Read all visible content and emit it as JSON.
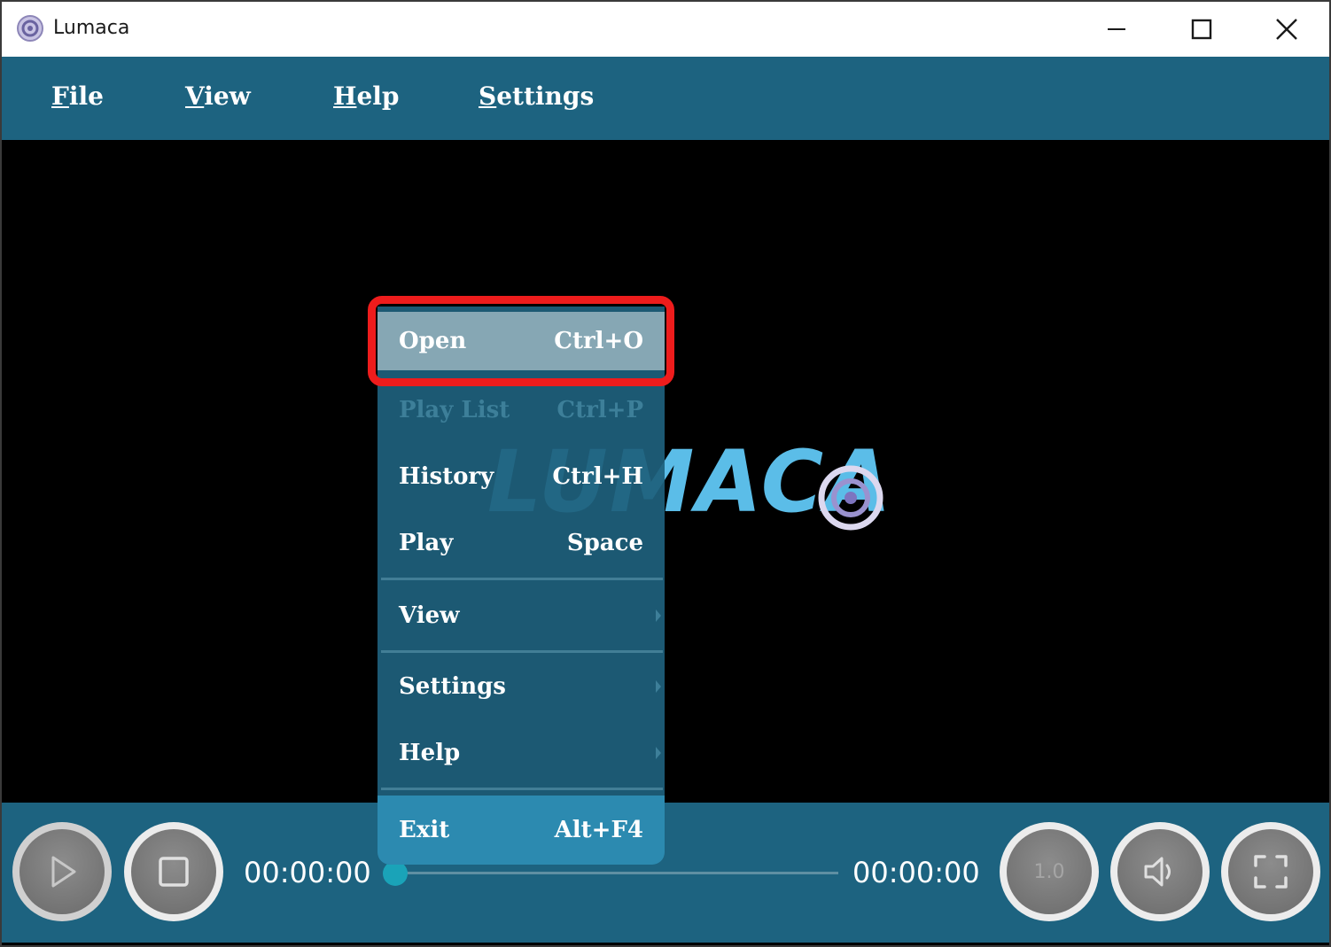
{
  "window": {
    "title": "Lumaca"
  },
  "menubar": {
    "items": [
      {
        "mnemonic": "F",
        "rest": "ile"
      },
      {
        "mnemonic": "V",
        "rest": "iew"
      },
      {
        "mnemonic": "H",
        "rest": "elp"
      },
      {
        "mnemonic": "S",
        "rest": "ettings"
      }
    ]
  },
  "logo": {
    "text": "LUMACA"
  },
  "context_menu": {
    "items": [
      {
        "label": "Open",
        "shortcut": "Ctrl+O",
        "state": "highlighted"
      },
      {
        "label": "Play List",
        "shortcut": "Ctrl+P",
        "state": "disabled"
      },
      {
        "label": "History",
        "shortcut": "Ctrl+H",
        "state": "normal"
      },
      {
        "label": "Play",
        "shortcut": "Space",
        "state": "normal"
      },
      {
        "label": "View",
        "submenu": true
      },
      {
        "label": "Settings",
        "submenu": true
      },
      {
        "label": "Help",
        "submenu": true
      },
      {
        "label": "Exit",
        "shortcut": "Alt+F4",
        "state": "normal"
      }
    ]
  },
  "controls": {
    "current_time": "00:00:00",
    "total_time": "00:00:00",
    "speed": "1.0",
    "progress": 0
  },
  "colors": {
    "bar": "#1d6380",
    "highlight_outline": "#ee1c1c",
    "logo": "#5bbde8"
  }
}
